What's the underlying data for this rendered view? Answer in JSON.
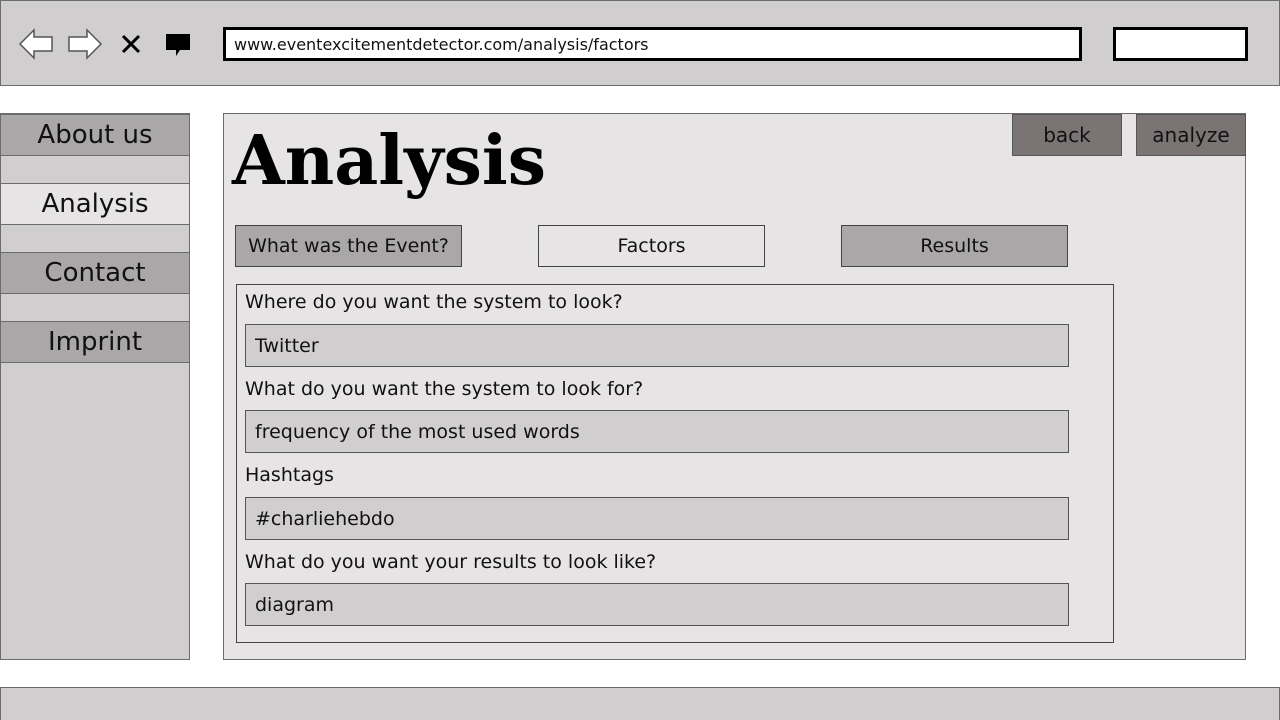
{
  "browser": {
    "url": "www.eventexcitementdetector.com/analysis/factors",
    "search_value": "",
    "icons": [
      "back-arrow-icon",
      "forward-arrow-icon",
      "close-icon",
      "chat-bubble-icon"
    ]
  },
  "sidebar": {
    "items": [
      {
        "label": "About us",
        "active": false
      },
      {
        "label": "Analysis",
        "active": true
      },
      {
        "label": "Contact",
        "active": false
      },
      {
        "label": "Imprint",
        "active": false
      }
    ]
  },
  "main": {
    "title": "Analysis",
    "back_label": "back",
    "analyze_label": "analyze",
    "tabs": [
      {
        "label": "What was the Event?",
        "active": false
      },
      {
        "label": "Factors",
        "active": true
      },
      {
        "label": "Results",
        "active": false
      }
    ],
    "form": {
      "questions": [
        {
          "label": "Where do you want the system to look?",
          "value": "Twitter"
        },
        {
          "label": "What do you want the system to look for?",
          "value": "frequency of the most used words"
        },
        {
          "label": "Hashtags",
          "value": "#charliehebdo"
        },
        {
          "label": "What do you want your results to look like?",
          "value": "diagram"
        }
      ]
    }
  },
  "colors": {
    "chrome_gray": "#d0cecf",
    "panel_light": "#e6e4e5",
    "button_mid": "#a9a7a8",
    "button_dark": "#7a7475",
    "border": "#6b6b6b"
  }
}
